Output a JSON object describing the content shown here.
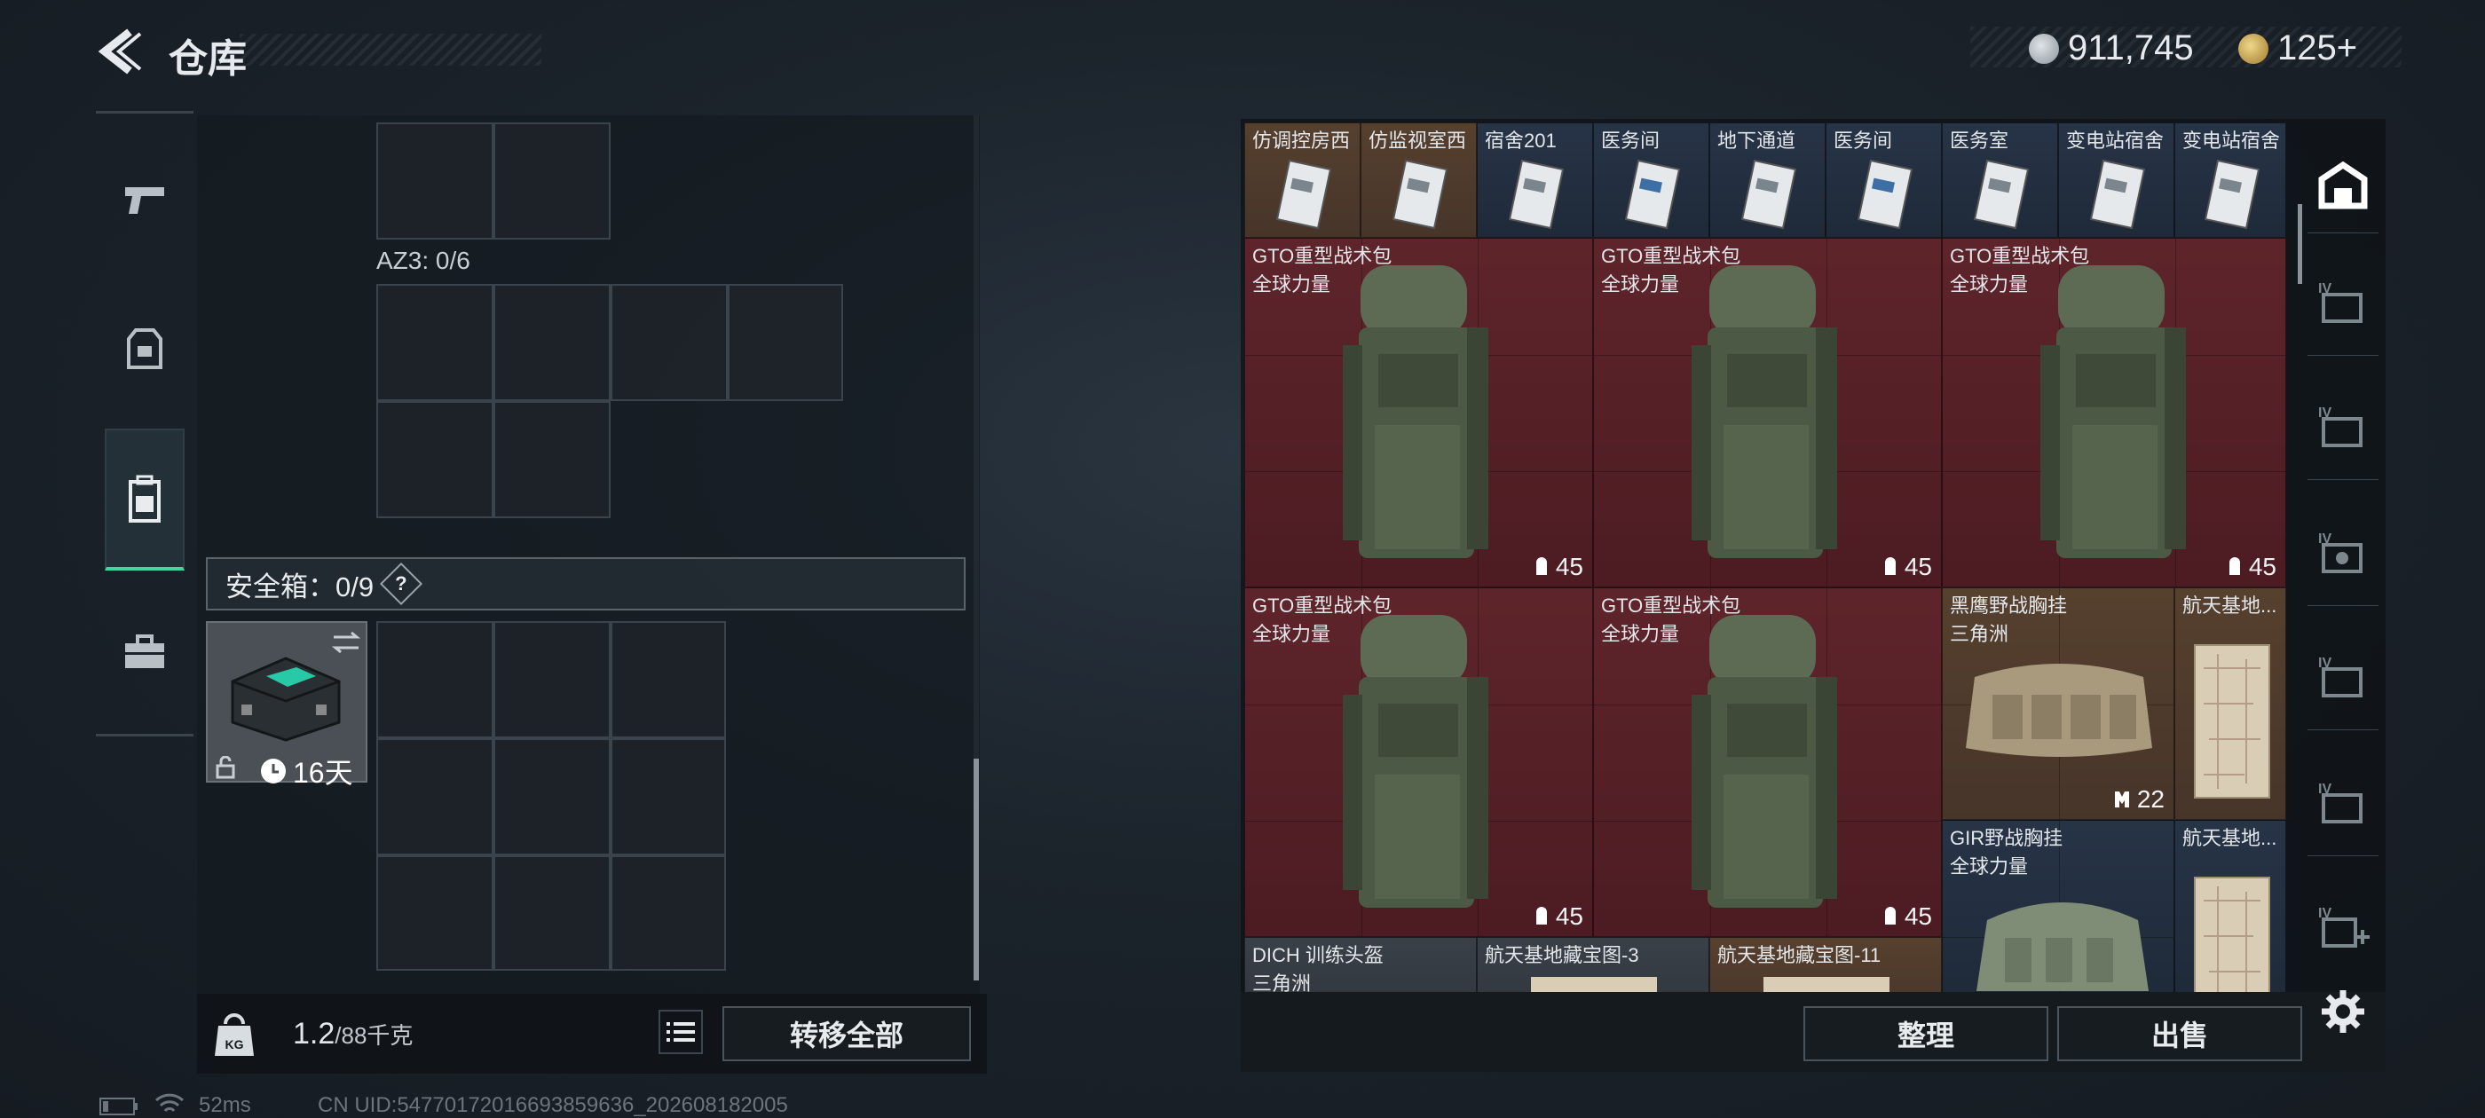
{
  "header": {
    "title": "仓库"
  },
  "currency": {
    "coins": "911,745",
    "tickets": "125+"
  },
  "left_tabs": [
    {
      "name": "weapon",
      "icon": "pistol-icon"
    },
    {
      "name": "armor",
      "icon": "vest-icon"
    },
    {
      "name": "backpack",
      "icon": "backpack-icon",
      "active": true
    },
    {
      "name": "case",
      "icon": "briefcase-icon"
    }
  ],
  "storage": {
    "az3_label": "AZ3: 0/6",
    "safe_label": "安全箱：0/9",
    "help": "?",
    "safe_timer": "16天",
    "weight_value": "1.2",
    "weight_max": "/88千克",
    "transfer_all": "转移全部"
  },
  "items": [
    {
      "name": "仿调控房西",
      "color": "brown"
    },
    {
      "name": "仿监视室西",
      "color": "brown"
    },
    {
      "name": "宿舍201",
      "color": "blue"
    },
    {
      "name": "医务间",
      "color": "blue"
    },
    {
      "name": "地下通道",
      "color": "blue"
    },
    {
      "name": "医务间",
      "color": "blue"
    },
    {
      "name": "医务室",
      "color": "blue"
    },
    {
      "name": "变电站宿舍",
      "color": "blue"
    },
    {
      "name": "变电站宿舍",
      "color": "blue"
    },
    {
      "name": "GTO重型战术包",
      "sub": "全球力量",
      "count": "45",
      "color": "red"
    },
    {
      "name": "GTO重型战术包",
      "sub": "全球力量",
      "count": "45",
      "color": "red"
    },
    {
      "name": "GTO重型战术包",
      "sub": "全球力量",
      "count": "45",
      "color": "red"
    },
    {
      "name": "GTO重型战术包",
      "sub": "全球力量",
      "count": "45",
      "color": "red"
    },
    {
      "name": "GTO重型战术包",
      "sub": "全球力量",
      "count": "45",
      "color": "red"
    },
    {
      "name": "黑鹰野战胸挂",
      "sub": "三角洲",
      "count": "22",
      "color": "brown"
    },
    {
      "name": "航天基地...",
      "color": "brown"
    },
    {
      "name": "GIR野战胸挂",
      "sub": "全球力量",
      "color": "blue"
    },
    {
      "name": "航天基地...",
      "color": "blue"
    },
    {
      "name": "DICH 训练头盔",
      "sub": "三角洲",
      "color": "grey"
    },
    {
      "name": "航天基地藏宝图-3",
      "color": "grey"
    },
    {
      "name": "航天基地藏宝图-11",
      "color": "brown"
    }
  ],
  "right_rail": [
    "warehouse-icon",
    "storage-iv-1-icon",
    "storage-iv-2-icon",
    "storage-iv-3-icon",
    "storage-iv-4-icon",
    "storage-iv-5-icon",
    "storage-iv-add-icon",
    "settings-icon"
  ],
  "actions": {
    "sort": "整理",
    "sell": "出售"
  },
  "status": {
    "ping": "52ms",
    "uid": "CN UID:5477017201669385963​6_202608182005"
  }
}
